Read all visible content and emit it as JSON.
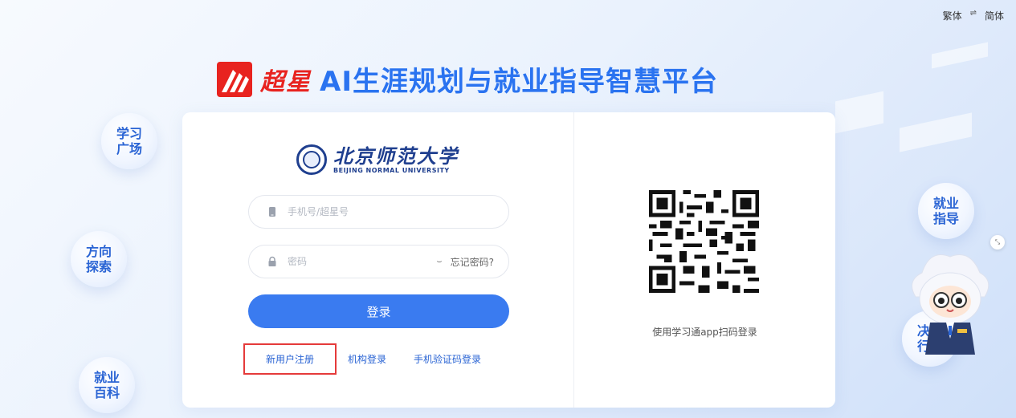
{
  "lang": {
    "traditional": "繁体",
    "swap": "⇌",
    "simplified": "简体"
  },
  "brand": {
    "logo_text": "超星",
    "title": "AI生涯规划与就业指导智慧平台"
  },
  "university": {
    "name_cn": "北京师范大学",
    "name_en": "BEIJING NORMAL UNIVERSITY"
  },
  "form": {
    "phone_placeholder": "手机号/超星号",
    "password_placeholder": "密码",
    "forgot_label": "忘记密码?",
    "login_label": "登录"
  },
  "links": {
    "register": "新用户注册",
    "org_login": "机构登录",
    "sms_login": "手机验证码登录"
  },
  "qr": {
    "caption": "使用学习通app扫码登录"
  },
  "bubbles": {
    "study_square": "学习广场",
    "direction": "方向探索",
    "encyclopedia": "就业百科",
    "guidance": "就业指导",
    "action": "决策行动"
  },
  "colors": {
    "accent": "#3a7bf0",
    "brand_red": "#e8231f",
    "highlight": "#e53a3a"
  }
}
